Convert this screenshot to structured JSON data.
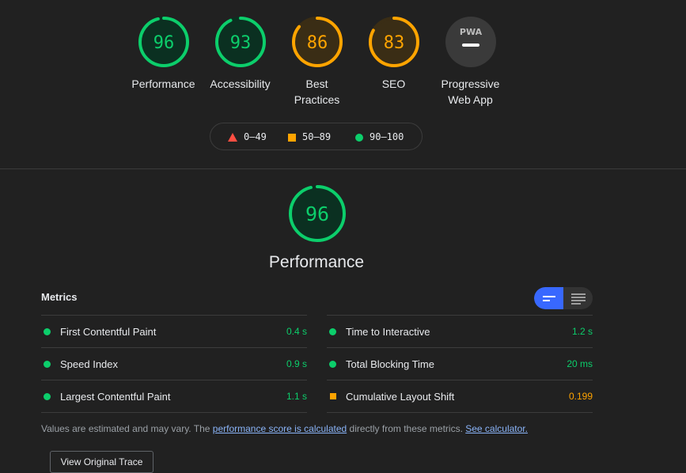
{
  "colors": {
    "good": "#0cce6b",
    "good_bg": "#0b3021",
    "average": "#ffa400",
    "average_bg": "#3a2d15",
    "fail": "#ff4e42",
    "neutral_bg": "#3a3a3a",
    "accent": "#3868ff"
  },
  "categories": [
    {
      "score": "96",
      "label": "Performance",
      "rating": "good",
      "value": 0.96
    },
    {
      "score": "93",
      "label": "Accessibility",
      "rating": "good",
      "value": 0.93
    },
    {
      "score": "86",
      "label_line1": "Best",
      "label_line2": "Practices",
      "rating": "average",
      "value": 0.86
    },
    {
      "score": "83",
      "label": "SEO",
      "rating": "average",
      "value": 0.83
    },
    {
      "badge": "PWA",
      "label_line1": "Progressive",
      "label_line2": "Web App",
      "rating": "neutral",
      "icon": "pwa-dash-icon"
    }
  ],
  "legend": [
    {
      "range": "0–49",
      "icon": "triangle-icon"
    },
    {
      "range": "50–89",
      "icon": "square-icon"
    },
    {
      "range": "90–100",
      "icon": "circle-icon"
    }
  ],
  "performance": {
    "score": "96",
    "value": 0.96,
    "title": "Performance"
  },
  "metrics": {
    "header": "Metrics",
    "left": [
      {
        "name": "First Contentful Paint",
        "value": "0.4 s",
        "rating": "good"
      },
      {
        "name": "Speed Index",
        "value": "0.9 s",
        "rating": "good"
      },
      {
        "name": "Largest Contentful Paint",
        "value": "1.1 s",
        "rating": "good"
      }
    ],
    "right": [
      {
        "name": "Time to Interactive",
        "value": "1.2 s",
        "rating": "good"
      },
      {
        "name": "Total Blocking Time",
        "value": "20 ms",
        "rating": "good"
      },
      {
        "name": "Cumulative Layout Shift",
        "value": "0.199",
        "rating": "average"
      }
    ]
  },
  "note": {
    "prefix": "Values are estimated and may vary. The ",
    "link1": "performance score is calculated",
    "middle": " directly from these metrics. ",
    "link2": "See calculator."
  },
  "trace_button": "View Original Trace"
}
